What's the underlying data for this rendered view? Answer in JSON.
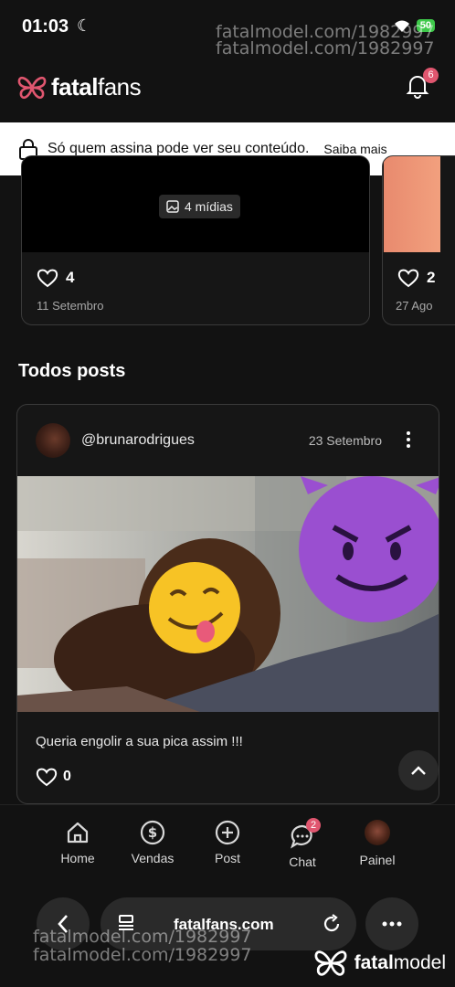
{
  "status_bar": {
    "time": "01:03",
    "battery": "50"
  },
  "watermark": {
    "text": "fatalmodel.com/1982997"
  },
  "header": {
    "logo_prefix": "fatal",
    "logo_suffix": "fans",
    "notifications_count": "6"
  },
  "notice": {
    "text": "Só quem assina pode ver seu conteúdo.",
    "link": "Saiba mais"
  },
  "featured_cards": [
    {
      "media_label": "4 mídias",
      "likes": "4",
      "date": "11 Setembro"
    },
    {
      "likes": "2",
      "date": "27 Ago"
    }
  ],
  "section": {
    "title": "Todos posts"
  },
  "post": {
    "username": "@brunarodrigues",
    "date": "23 Setembro",
    "caption": "Queria engolir a sua pica assim !!!",
    "likes": "0"
  },
  "bottom_nav": {
    "items": [
      {
        "label": "Home"
      },
      {
        "label": "Vendas"
      },
      {
        "label": "Post"
      },
      {
        "label": "Chat",
        "badge": "2"
      },
      {
        "label": "Painel"
      }
    ]
  },
  "browser": {
    "url": "fatalfans.com"
  },
  "brand": {
    "name_prefix": "fatal",
    "name_suffix": "model"
  },
  "colors": {
    "accent": "#e0566f",
    "background": "#121212",
    "card_border": "#3a3a3a"
  }
}
